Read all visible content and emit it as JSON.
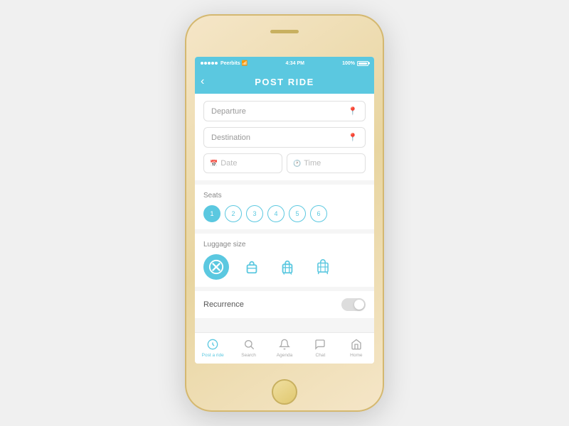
{
  "status_bar": {
    "carrier": "Peerbits",
    "wifi": "wifi",
    "time": "4:34 PM",
    "battery": "100%"
  },
  "header": {
    "back_label": "‹",
    "title": "POST RIDE"
  },
  "form": {
    "departure_placeholder": "Departure",
    "destination_placeholder": "Destination",
    "date_placeholder": "Date",
    "time_placeholder": "Time"
  },
  "seats": {
    "label": "Seats",
    "options": [
      "1",
      "2",
      "3",
      "4",
      "5",
      "6"
    ],
    "active_index": 0
  },
  "luggage": {
    "label": "Luggage size",
    "options": [
      "none",
      "small",
      "medium",
      "large"
    ],
    "active_index": 0
  },
  "recurrence": {
    "label": "Recurrence",
    "enabled": false
  },
  "bottom_nav": {
    "items": [
      {
        "label": "Post a ride",
        "icon": "post"
      },
      {
        "label": "Search",
        "icon": "search"
      },
      {
        "label": "Agenda",
        "icon": "agenda"
      },
      {
        "label": "Chat",
        "icon": "chat"
      },
      {
        "label": "Home",
        "icon": "home"
      }
    ],
    "active_index": 0
  }
}
